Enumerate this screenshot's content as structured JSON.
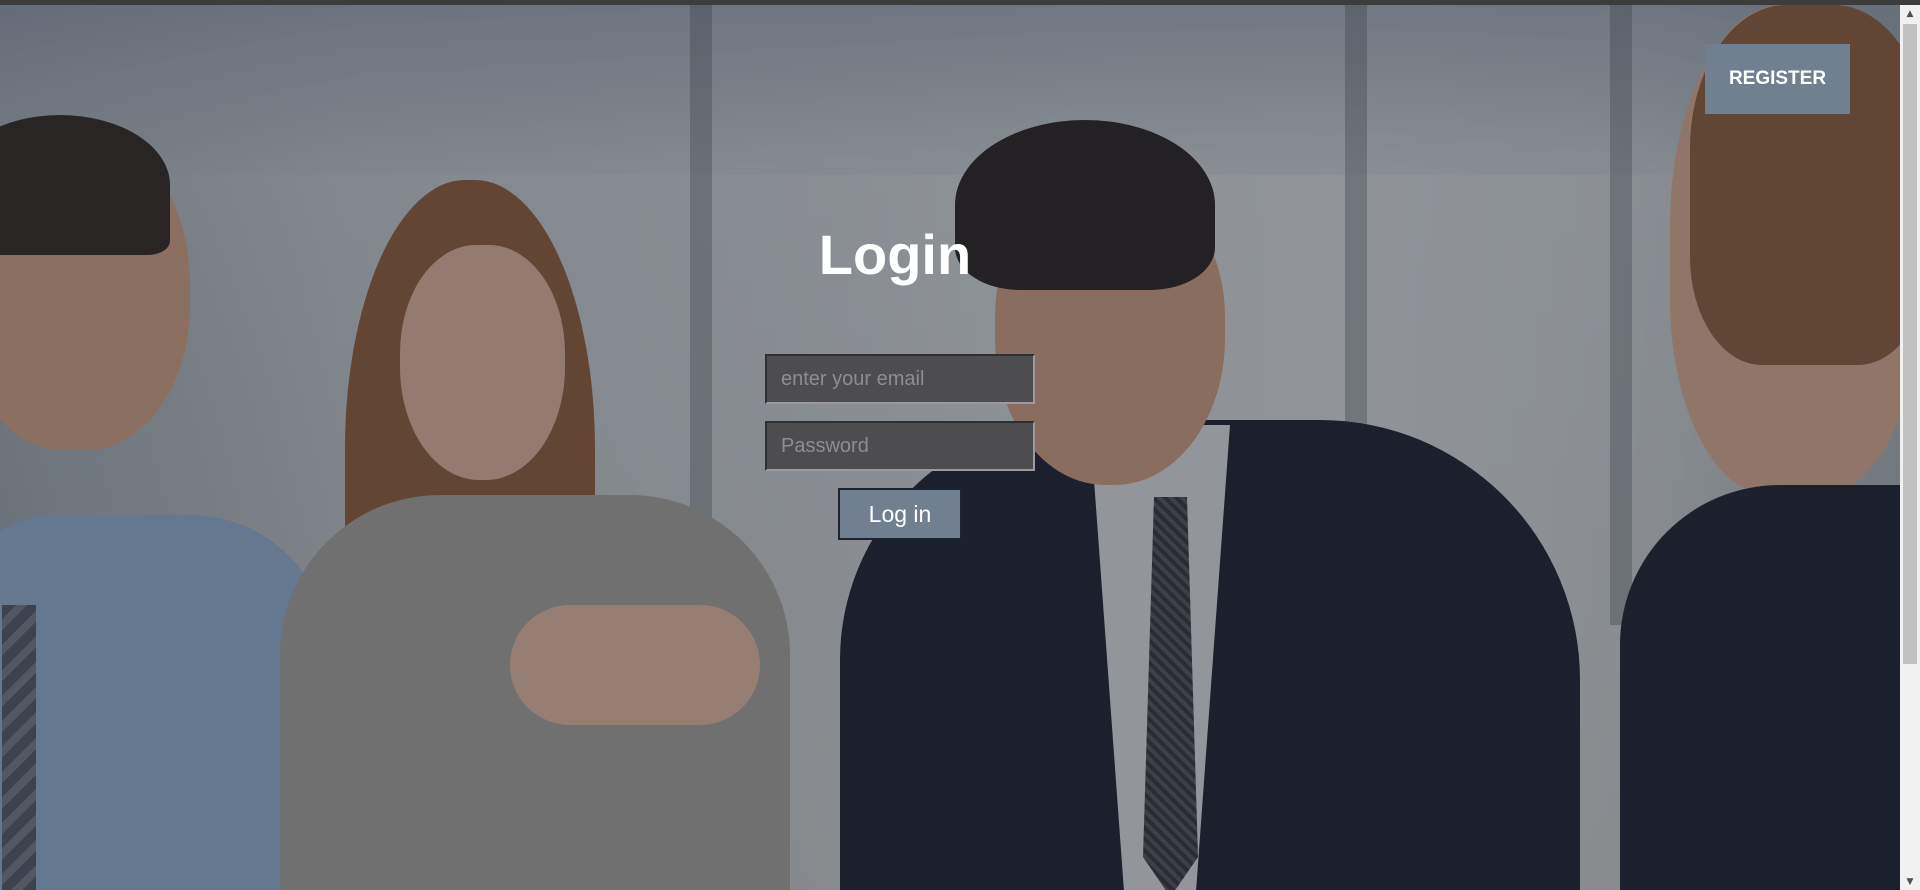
{
  "header": {
    "register_label": "REGISTER"
  },
  "login": {
    "title": "Login",
    "email_placeholder": "enter your email",
    "email_value": "",
    "password_placeholder": "Password",
    "password_value": "",
    "submit_label": "Log in"
  },
  "colors": {
    "button_bg": "#708090",
    "button_text": "#ffffff",
    "field_bg": "#4d4d4f",
    "title_color": "#ffffff"
  },
  "icons": {
    "scroll_up": "scroll-up-arrow-icon",
    "scroll_down": "scroll-down-arrow-icon"
  }
}
